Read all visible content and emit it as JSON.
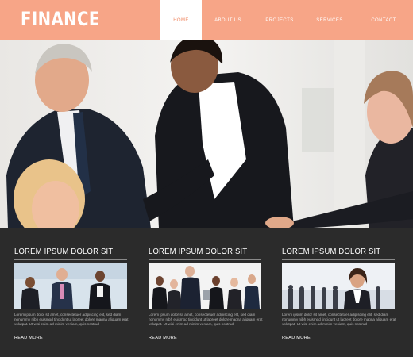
{
  "header": {
    "logo": "FINANCE",
    "brand_color": "#f7a587",
    "nav": [
      {
        "label": "HOME",
        "active": true
      },
      {
        "label": "ABOUT US",
        "active": false
      },
      {
        "label": "PROJECTS",
        "active": false
      },
      {
        "label": "SERVICES",
        "active": false
      },
      {
        "label": "CONTACT",
        "active": false
      }
    ]
  },
  "hero": {
    "image": "business-team-handshake-photo"
  },
  "features": [
    {
      "title": "LOREM IPSUM DOLOR SIT",
      "image": "business-team-photo",
      "text": "Lorem ipsum dolor sit amet, consectetuer adipiscing elit, sed diam nonummy nibh euismod tincidunt ut laoreet dolore magna aliquam erat volutpat. Ut wisi enim ad minim veniam, quis nostrud",
      "link": "READ MORE"
    },
    {
      "title": "LOREM IPSUM DOLOR SIT",
      "image": "business-group-photo",
      "text": "Lorem ipsum dolor sit amet, consectetuer adipiscing elit, sed diam nonummy nibh euismod tincidunt ut laoreet dolore magna aliquam erat volutpat. Ut wisi enim ad minim veniam, quis nostrud",
      "link": "READ MORE"
    },
    {
      "title": "LOREM IPSUM DOLOR SIT",
      "image": "businesswoman-photo",
      "text": "Lorem ipsum dolor sit amet, consectetuer adipiscing elit, sed diam nonummy nibh euismod tincidunt ut laoreet dolore magna aliquam erat volutpat. Ut wisi enim ad minim veniam, quis nostrud",
      "link": "READ MORE"
    }
  ]
}
